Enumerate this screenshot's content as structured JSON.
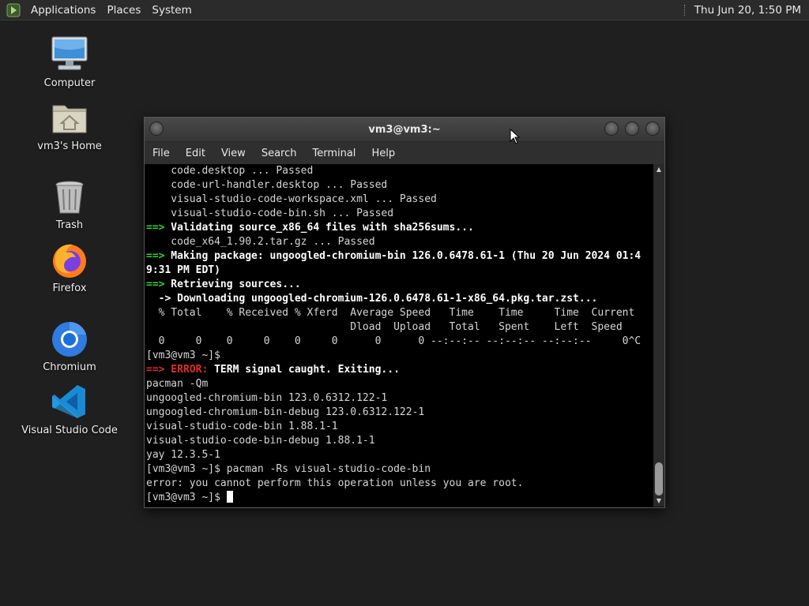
{
  "panel": {
    "menus": [
      "Applications",
      "Places",
      "System"
    ],
    "clock": "Thu Jun 20,  1:50 PM"
  },
  "desktop": {
    "icons": [
      {
        "label": "Computer",
        "icon": "computer-icon"
      },
      {
        "label": "vm3's Home",
        "icon": "home-folder-icon"
      },
      {
        "label": "Trash",
        "icon": "trash-icon"
      },
      {
        "label": "Firefox",
        "icon": "firefox-icon"
      },
      {
        "label": "Chromium",
        "icon": "chromium-icon"
      },
      {
        "label": "Visual Studio Code",
        "icon": "vscode-icon"
      }
    ]
  },
  "terminal": {
    "title": "vm3@vm3:~",
    "menu": [
      "File",
      "Edit",
      "View",
      "Search",
      "Terminal",
      "Help"
    ],
    "lines": [
      "    code.desktop ... Passed",
      "    code-url-handler.desktop ... Passed",
      "    visual-studio-code-workspace.xml ... Passed",
      "    visual-studio-code-bin.sh ... Passed",
      "==> Validating source_x86_64 files with sha256sums...",
      "    code_x64_1.90.2.tar.gz ... Passed",
      "==> Making package: ungoogled-chromium-bin 126.0.6478.61-1 (Thu 20 Jun 2024 01:4",
      "9:31 PM EDT)",
      "==> Retrieving sources...",
      "  -> Downloading ungoogled-chromium-126.0.6478.61-1-x86_64.pkg.tar.zst...",
      "  % Total    % Received % Xferd  Average Speed   Time    Time     Time  Current",
      "                                 Dload  Upload   Total   Spent    Left  Speed",
      "  0     0    0     0    0     0      0      0 --:--:-- --:--:-- --:--:--     0^C",
      "[vm3@vm3 ~]$",
      "==> ERROR: TERM signal caught. Exiting...",
      "pacman -Qm",
      "ungoogled-chromium-bin 123.0.6312.122-1",
      "ungoogled-chromium-bin-debug 123.0.6312.122-1",
      "visual-studio-code-bin 1.88.1-1",
      "visual-studio-code-bin-debug 1.88.1-1",
      "yay 12.3.5-1",
      "[vm3@vm3 ~]$ pacman -Rs visual-studio-code-bin",
      "error: you cannot perform this operation unless you are root.",
      "[vm3@vm3 ~]$ "
    ]
  },
  "colors": {
    "desktop_bg": "#1f1f1f",
    "prompt_arrow_green": "#2fd52f",
    "error_red": "#e12b2b"
  }
}
